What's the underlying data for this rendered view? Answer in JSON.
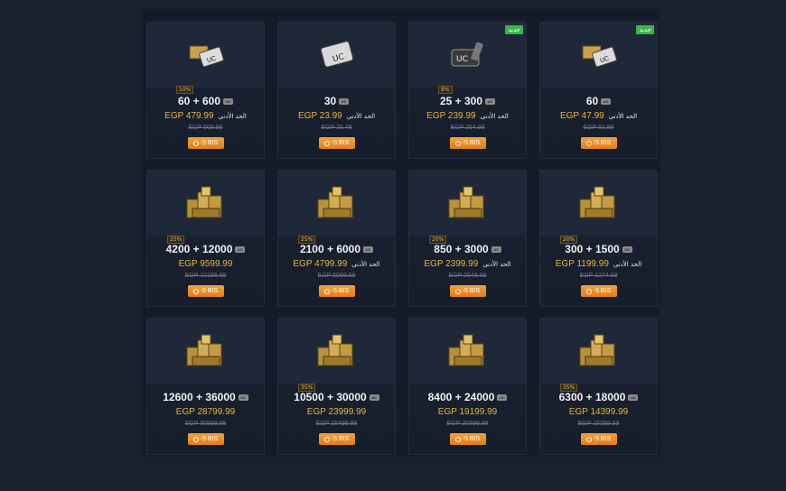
{
  "colors": {
    "accent": "#e8b43a",
    "discount": "#f08c2a",
    "new_tag": "#39b54a",
    "card_bg": "#1b2334"
  },
  "products": [
    {
      "bonus": "10%",
      "qty": "60 + 600",
      "price": "EGP 479.99",
      "min_label": "الحد الأدنى",
      "old": "EGP 509.99",
      "discount": "-5 BIS",
      "new": false,
      "icon": "uc-pack-small-icon"
    },
    {
      "bonus": "",
      "qty": "30",
      "price": "EGP 23.99",
      "min_label": "الحد الأدنى",
      "old": "EGP 26.49",
      "discount": "-5 BIS",
      "new": false,
      "icon": "uc-card-icon"
    },
    {
      "bonus": "8%",
      "qty": "25 + 300",
      "price": "EGP 239.99",
      "min_label": "الحد الأدنى",
      "old": "EGP 254.99",
      "discount": "-5 BIS",
      "new": true,
      "new_label": "جديد",
      "icon": "uc-bag-icon"
    },
    {
      "bonus": "",
      "qty": "60",
      "price": "EGP 47.99",
      "min_label": "الحد الأدنى",
      "old": "EGP 50.99",
      "discount": "-5 BIS",
      "new": true,
      "new_label": "جديد",
      "icon": "uc-pack-small-icon"
    },
    {
      "bonus": "25%",
      "qty": "4200 + 12000",
      "price": "EGP 9599.99",
      "min_label": "",
      "old": "EGP 10199.99",
      "discount": "-5 BIS",
      "new": false,
      "icon": "uc-stack-icon"
    },
    {
      "bonus": "25%",
      "qty": "2100 + 6000",
      "price": "EGP 4799.99",
      "min_label": "الحد الأدنى",
      "old": "EGP 5099.99",
      "discount": "-5 BIS",
      "new": false,
      "icon": "uc-stack-icon"
    },
    {
      "bonus": "20%",
      "qty": "850 + 3000",
      "price": "EGP 2399.99",
      "min_label": "الحد الأدنى",
      "old": "EGP 2549.99",
      "discount": "-5 BIS",
      "new": false,
      "icon": "uc-stack-icon"
    },
    {
      "bonus": "20%",
      "qty": "300 + 1500",
      "price": "EGP 1199.99",
      "min_label": "الحد الأدنى",
      "old": "EGP 1274.99",
      "discount": "-5 BIS",
      "new": false,
      "icon": "uc-stack-icon"
    },
    {
      "bonus": "",
      "qty": "12600 + 36000",
      "price": "EGP 28799.99",
      "min_label": "",
      "old": "EGP 30599.99",
      "discount": "-5 BIS",
      "new": false,
      "icon": "uc-stack-icon"
    },
    {
      "bonus": "35%",
      "qty": "10500 + 30000",
      "price": "EGP 23999.99",
      "min_label": "",
      "old": "EGP 25499.99",
      "discount": "-5 BIS",
      "new": false,
      "icon": "uc-stack-icon"
    },
    {
      "bonus": "",
      "qty": "8400 + 24000",
      "price": "EGP 19199.99",
      "min_label": "",
      "old": "EGP 20399.99",
      "discount": "-5 BIS",
      "new": false,
      "icon": "uc-stack-icon"
    },
    {
      "bonus": "35%",
      "qty": "6300 + 18000",
      "price": "EGP 14399.99",
      "min_label": "",
      "old": "EGP 15299.99",
      "discount": "-5 BIS",
      "new": false,
      "icon": "uc-stack-icon"
    }
  ]
}
